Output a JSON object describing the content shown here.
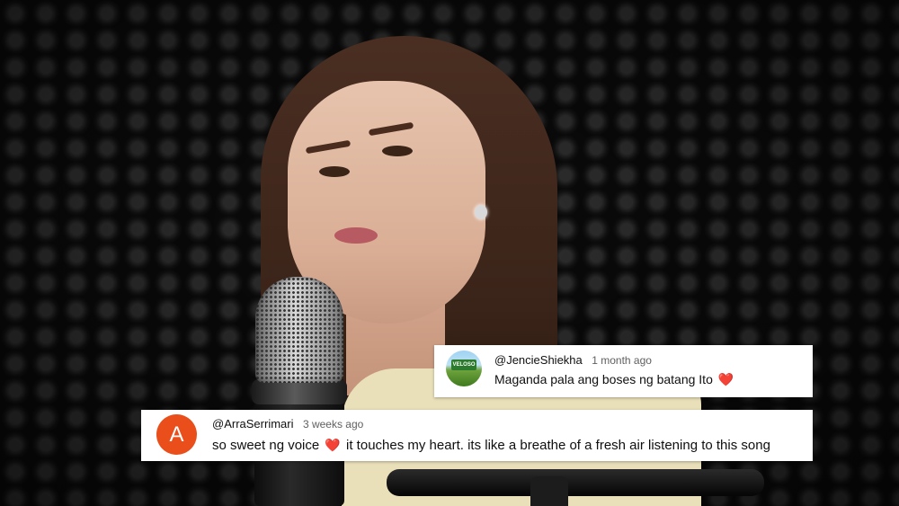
{
  "comments": [
    {
      "handle": "@JencieShiekha",
      "time": "1 month ago",
      "text": "Maganda pala ang boses ng batang Ito",
      "avatar_text": "VELOSO",
      "emoji": "❤️"
    },
    {
      "handle": "@ArraSerrimari",
      "time": "3 weeks ago",
      "text_before": "so sweet ng voice",
      "text_after": "it touches my heart. its like a breathe of a fresh air listening to this song",
      "avatar_letter": "A",
      "avatar_color": "#e94e1b",
      "emoji": "❤️"
    }
  ],
  "colors": {
    "heart": "#e0332f",
    "comment_background": "#ffffff",
    "timestamp": "#606060"
  }
}
